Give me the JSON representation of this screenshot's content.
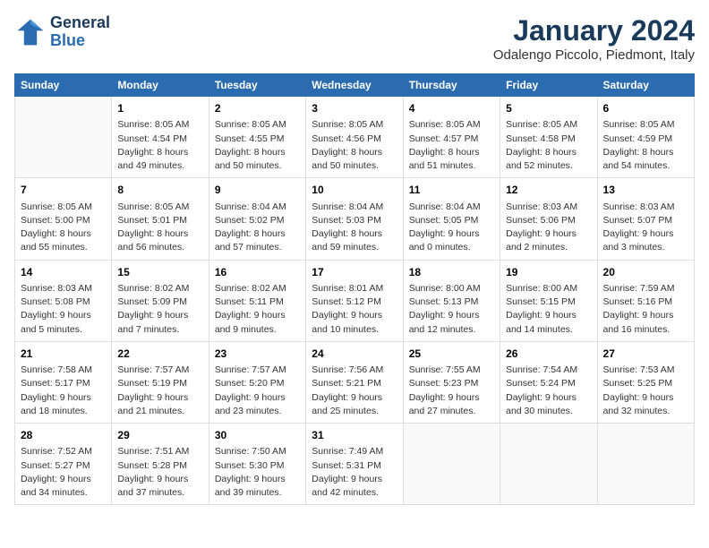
{
  "header": {
    "logo_line1": "General",
    "logo_line2": "Blue",
    "month": "January 2024",
    "location": "Odalengo Piccolo, Piedmont, Italy"
  },
  "weekdays": [
    "Sunday",
    "Monday",
    "Tuesday",
    "Wednesday",
    "Thursday",
    "Friday",
    "Saturday"
  ],
  "weeks": [
    [
      {
        "day": "",
        "info": ""
      },
      {
        "day": "1",
        "info": "Sunrise: 8:05 AM\nSunset: 4:54 PM\nDaylight: 8 hours\nand 49 minutes."
      },
      {
        "day": "2",
        "info": "Sunrise: 8:05 AM\nSunset: 4:55 PM\nDaylight: 8 hours\nand 50 minutes."
      },
      {
        "day": "3",
        "info": "Sunrise: 8:05 AM\nSunset: 4:56 PM\nDaylight: 8 hours\nand 50 minutes."
      },
      {
        "day": "4",
        "info": "Sunrise: 8:05 AM\nSunset: 4:57 PM\nDaylight: 8 hours\nand 51 minutes."
      },
      {
        "day": "5",
        "info": "Sunrise: 8:05 AM\nSunset: 4:58 PM\nDaylight: 8 hours\nand 52 minutes."
      },
      {
        "day": "6",
        "info": "Sunrise: 8:05 AM\nSunset: 4:59 PM\nDaylight: 8 hours\nand 54 minutes."
      }
    ],
    [
      {
        "day": "7",
        "info": "Sunrise: 8:05 AM\nSunset: 5:00 PM\nDaylight: 8 hours\nand 55 minutes."
      },
      {
        "day": "8",
        "info": "Sunrise: 8:05 AM\nSunset: 5:01 PM\nDaylight: 8 hours\nand 56 minutes."
      },
      {
        "day": "9",
        "info": "Sunrise: 8:04 AM\nSunset: 5:02 PM\nDaylight: 8 hours\nand 57 minutes."
      },
      {
        "day": "10",
        "info": "Sunrise: 8:04 AM\nSunset: 5:03 PM\nDaylight: 8 hours\nand 59 minutes."
      },
      {
        "day": "11",
        "info": "Sunrise: 8:04 AM\nSunset: 5:05 PM\nDaylight: 9 hours\nand 0 minutes."
      },
      {
        "day": "12",
        "info": "Sunrise: 8:03 AM\nSunset: 5:06 PM\nDaylight: 9 hours\nand 2 minutes."
      },
      {
        "day": "13",
        "info": "Sunrise: 8:03 AM\nSunset: 5:07 PM\nDaylight: 9 hours\nand 3 minutes."
      }
    ],
    [
      {
        "day": "14",
        "info": "Sunrise: 8:03 AM\nSunset: 5:08 PM\nDaylight: 9 hours\nand 5 minutes."
      },
      {
        "day": "15",
        "info": "Sunrise: 8:02 AM\nSunset: 5:09 PM\nDaylight: 9 hours\nand 7 minutes."
      },
      {
        "day": "16",
        "info": "Sunrise: 8:02 AM\nSunset: 5:11 PM\nDaylight: 9 hours\nand 9 minutes."
      },
      {
        "day": "17",
        "info": "Sunrise: 8:01 AM\nSunset: 5:12 PM\nDaylight: 9 hours\nand 10 minutes."
      },
      {
        "day": "18",
        "info": "Sunrise: 8:00 AM\nSunset: 5:13 PM\nDaylight: 9 hours\nand 12 minutes."
      },
      {
        "day": "19",
        "info": "Sunrise: 8:00 AM\nSunset: 5:15 PM\nDaylight: 9 hours\nand 14 minutes."
      },
      {
        "day": "20",
        "info": "Sunrise: 7:59 AM\nSunset: 5:16 PM\nDaylight: 9 hours\nand 16 minutes."
      }
    ],
    [
      {
        "day": "21",
        "info": "Sunrise: 7:58 AM\nSunset: 5:17 PM\nDaylight: 9 hours\nand 18 minutes."
      },
      {
        "day": "22",
        "info": "Sunrise: 7:57 AM\nSunset: 5:19 PM\nDaylight: 9 hours\nand 21 minutes."
      },
      {
        "day": "23",
        "info": "Sunrise: 7:57 AM\nSunset: 5:20 PM\nDaylight: 9 hours\nand 23 minutes."
      },
      {
        "day": "24",
        "info": "Sunrise: 7:56 AM\nSunset: 5:21 PM\nDaylight: 9 hours\nand 25 minutes."
      },
      {
        "day": "25",
        "info": "Sunrise: 7:55 AM\nSunset: 5:23 PM\nDaylight: 9 hours\nand 27 minutes."
      },
      {
        "day": "26",
        "info": "Sunrise: 7:54 AM\nSunset: 5:24 PM\nDaylight: 9 hours\nand 30 minutes."
      },
      {
        "day": "27",
        "info": "Sunrise: 7:53 AM\nSunset: 5:25 PM\nDaylight: 9 hours\nand 32 minutes."
      }
    ],
    [
      {
        "day": "28",
        "info": "Sunrise: 7:52 AM\nSunset: 5:27 PM\nDaylight: 9 hours\nand 34 minutes."
      },
      {
        "day": "29",
        "info": "Sunrise: 7:51 AM\nSunset: 5:28 PM\nDaylight: 9 hours\nand 37 minutes."
      },
      {
        "day": "30",
        "info": "Sunrise: 7:50 AM\nSunset: 5:30 PM\nDaylight: 9 hours\nand 39 minutes."
      },
      {
        "day": "31",
        "info": "Sunrise: 7:49 AM\nSunset: 5:31 PM\nDaylight: 9 hours\nand 42 minutes."
      },
      {
        "day": "",
        "info": ""
      },
      {
        "day": "",
        "info": ""
      },
      {
        "day": "",
        "info": ""
      }
    ]
  ]
}
